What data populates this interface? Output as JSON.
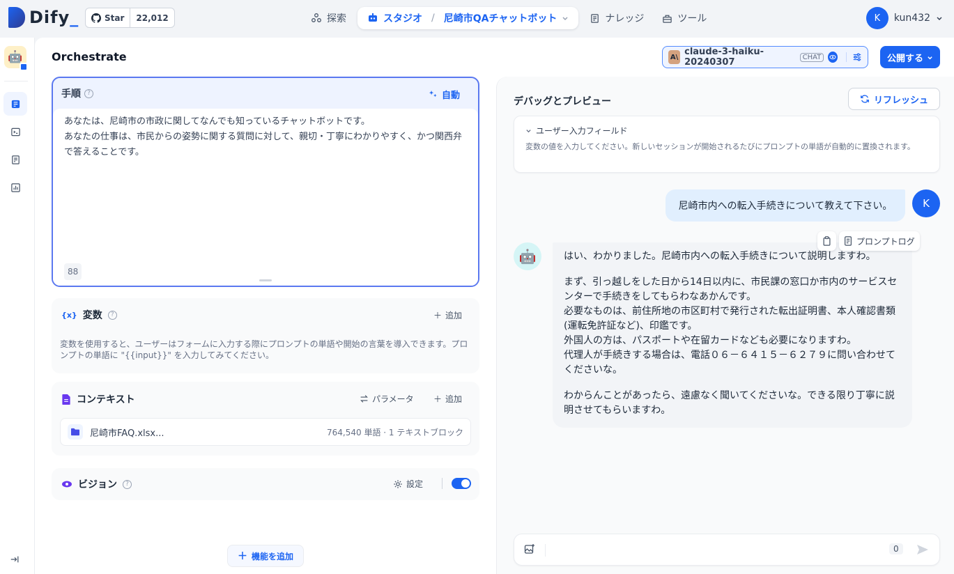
{
  "brand": {
    "name": "Dify",
    "accent": "#1c64f2"
  },
  "github": {
    "star_label": "Star",
    "count": "22,012"
  },
  "nav": {
    "explore": "探索",
    "studio": "スタジオ",
    "app_name": "尼崎市QAチャットボット",
    "knowledge": "ナレッジ",
    "tools": "ツール"
  },
  "user": {
    "initial": "K",
    "name": "kun432"
  },
  "header": {
    "title": "Orchestrate",
    "model_name": "claude-3-haiku-20240307",
    "model_mode": "CHAT",
    "publish_label": "公開する"
  },
  "instructions": {
    "title": "手順",
    "auto_label": "自動",
    "line1": "あなたは、尼崎市の市政に関してなんでも知っているチャットボットです。",
    "line2": "あなたの仕事は、市民からの姿勢に関する質問に対して、親切・丁寧にわかりやすく、かつ関西弁",
    "line3": "で答えることです。",
    "char_count": "88"
  },
  "variables": {
    "icon_text": "{x}",
    "title": "変数",
    "add_label": "追加",
    "description": "変数を使用すると、ユーザーはフォームに入力する際にプロンプトの単語や開始の言葉を導入できます。プロンプトの単語に \"{{input}}\" を入力してみてください。"
  },
  "context": {
    "title": "コンテキスト",
    "params_label": "パラメータ",
    "add_label": "追加",
    "file_name": "尼崎市FAQ.xlsx...",
    "file_meta": "764,540 単語 · 1 テキストブロック"
  },
  "vision": {
    "title": "ビジョン",
    "settings_label": "設定",
    "enabled": true
  },
  "add_feature_label": "機能を追加",
  "debug": {
    "title": "デバッグとプレビュー",
    "refresh_label": "リフレッシュ",
    "user_input_title": "ユーザー入力フィールド",
    "user_input_desc": "変数の値を入力してください。新しいセッションが開始されるたびにプロンプトの単語が自動的に置換されます。",
    "user_message": "尼崎市内への転入手続きについて教えて下さい。",
    "prompt_log_label": "プロンプトログ",
    "bot_p1": "はい、わかりました。尼崎市内への転入手続きについて説明しますわ。",
    "bot_p2_l1": "まず、引っ越しをした日から14日以内に、市民課の窓口か市内のサービスセンターで手続きをしてもらわなあかんです。",
    "bot_p2_l2": "必要なものは、前住所地の市区町村で発行された転出証明書、本人確認書類(運転免許証など)、印鑑です。",
    "bot_p2_l3": "外国人の方は、パスポートや在留カードなども必要になりますわ。",
    "bot_p2_l4": "代理人が手続きする場合は、電話０６－６４１５－６２７９に問い合わせてくださいな。",
    "bot_p3": "わからんことがあったら、遠慮なく聞いてくださいな。できる限り丁寧に説明させてもらいますわ。",
    "input_count": "0"
  }
}
